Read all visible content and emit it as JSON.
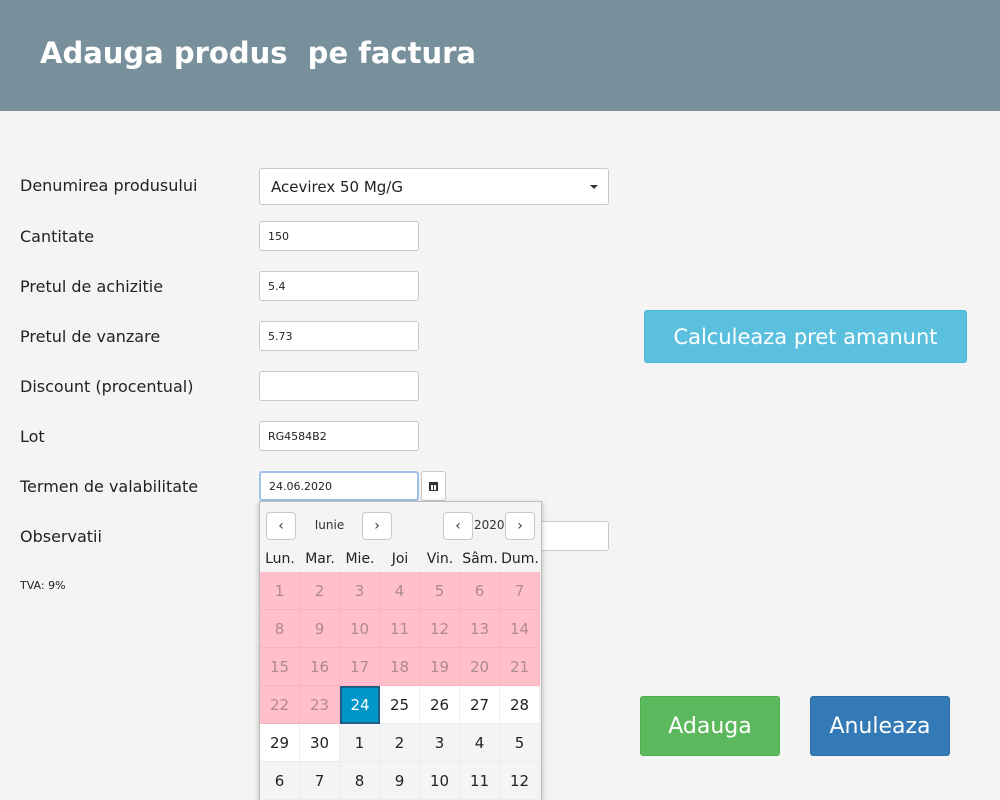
{
  "header": {
    "title": "Adauga produs  pe factura"
  },
  "form": {
    "product_label": "Denumirea produsului",
    "product_value": "Acevirex 50 Mg/G",
    "quantity_label": "Cantitate",
    "quantity_value": "150",
    "purchase_price_label": "Pretul de achizitie",
    "purchase_price_value": "5.4",
    "sale_price_label": "Pretul de vanzare",
    "sale_price_value": "5.73",
    "discount_label": "Discount (procentual)",
    "discount_value": "",
    "lot_label": "Lot",
    "lot_value": "RG4584B2",
    "expiry_label": "Termen de valabilitate",
    "expiry_value": "24.06.2020",
    "notes_label": "Observatii",
    "vat_text": "TVA: 9%"
  },
  "buttons": {
    "calc": "Calculeaza pret amanunt",
    "add": "Adauga",
    "cancel": "Anuleaza"
  },
  "calendar": {
    "month": "Iunie",
    "year": "2020",
    "prev_icon": "chevron-left-icon",
    "next_icon": "chevron-right-icon",
    "weekdays": [
      "Lun.",
      "Mar.",
      "Mie.",
      "Joi",
      "Vin.",
      "Sâm.",
      "Dum."
    ],
    "days": [
      [
        "1",
        "2",
        "3",
        "4",
        "5",
        "6",
        "7"
      ],
      [
        "8",
        "9",
        "10",
        "11",
        "12",
        "13",
        "14"
      ],
      [
        "15",
        "16",
        "17",
        "18",
        "19",
        "20",
        "21"
      ],
      [
        "22",
        "23",
        "24",
        "25",
        "26",
        "27",
        "28"
      ],
      [
        "29",
        "30",
        "1",
        "2",
        "3",
        "4",
        "5"
      ],
      [
        "6",
        "7",
        "8",
        "9",
        "10",
        "11",
        "12"
      ]
    ],
    "selected_day": "24",
    "past_until_day": 23
  },
  "colors": {
    "header": "#78909c",
    "past_day": "#ffc0cb",
    "selected_day": "#0096c9",
    "btn_calc": "#5bc0de",
    "btn_add": "#5cb85c",
    "btn_cancel": "#337ab7"
  }
}
